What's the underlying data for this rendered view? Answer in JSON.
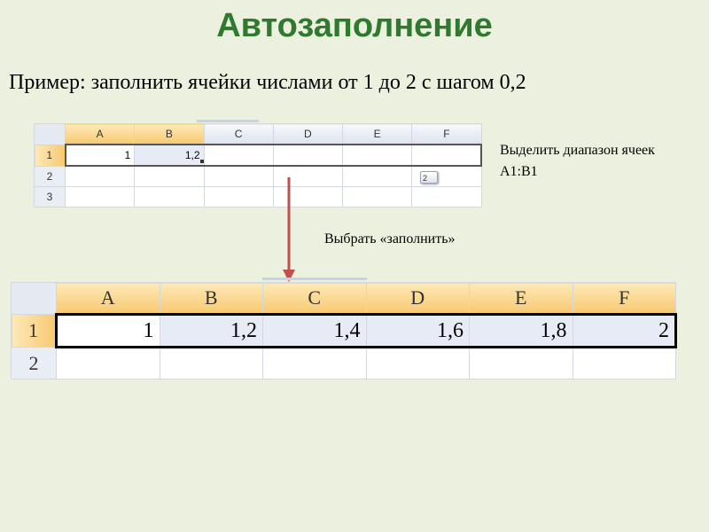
{
  "title": "Автозаполнение",
  "subtitle": "Пример: заполнить ячейки числами от 1 до 2 с шагом 0,2",
  "note_select": "Выделить диапазон ячеек А1:В1",
  "note_fill": "Выбрать «заполнить»",
  "small_sheet": {
    "columns": [
      "A",
      "B",
      "C",
      "D",
      "E",
      "F"
    ],
    "rows": [
      {
        "label": "1",
        "cells": [
          "1",
          "1,2",
          "",
          "",
          "",
          ""
        ]
      },
      {
        "label": "2",
        "cells": [
          "",
          "",
          "",
          "",
          "",
          ""
        ]
      },
      {
        "label": "3",
        "cells": [
          "",
          "",
          "",
          "",
          "",
          ""
        ]
      }
    ],
    "autofill_badge": "2"
  },
  "big_sheet": {
    "columns": [
      "A",
      "B",
      "C",
      "D",
      "E",
      "F"
    ],
    "rows": [
      {
        "label": "1",
        "cells": [
          "1",
          "1,2",
          "1,4",
          "1,6",
          "1,8",
          "2"
        ]
      },
      {
        "label": "2",
        "cells": [
          "",
          "",
          "",
          "",
          "",
          ""
        ]
      }
    ]
  },
  "colors": {
    "title": "#2f7a2f",
    "background": "#ebf1de",
    "arrow": "#c0504d"
  },
  "icons": {
    "arrow": "down-arrow-icon",
    "autofill": "autofill-options-icon"
  }
}
